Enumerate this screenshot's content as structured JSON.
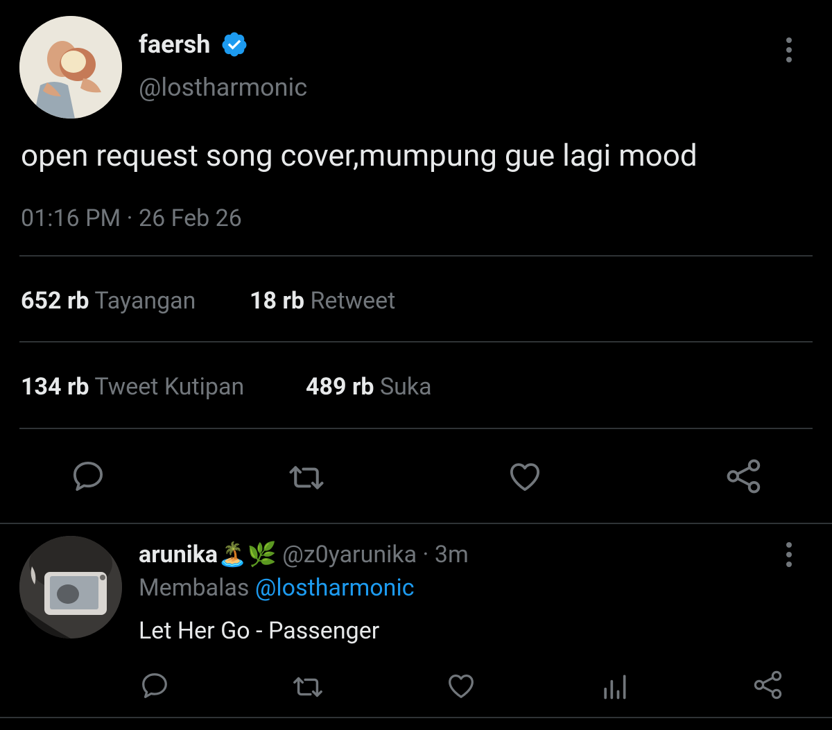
{
  "tweet": {
    "display_name": "faersh",
    "handle": "@lostharmonic",
    "text": "open request song cover,mumpung gue lagi mood",
    "time": "01:16 PM",
    "date": "26 Feb 26",
    "separator": "·",
    "stats": {
      "views_num": "652 rb",
      "views_label": "Tayangan",
      "retweets_num": "18 rb",
      "retweets_label": "Retweet",
      "quotes_num": "134 rb",
      "quotes_label": "Tweet Kutipan",
      "likes_num": "489 rb",
      "likes_label": "Suka"
    }
  },
  "reply": {
    "display_name": "arunika",
    "emojis": "🏝️🌿",
    "handle": "@z0yarunika",
    "separator": "·",
    "age": "3m",
    "replying_prefix": "Membalas",
    "replying_to": "@lostharmonic",
    "text": "Let Her Go - Passenger"
  },
  "colors": {
    "background": "#000000",
    "text": "#e7e9ea",
    "muted": "#71767b",
    "accent": "#1d9bf0",
    "divider": "#2f3336"
  },
  "icons": [
    "verified-badge-icon",
    "more-options-icon",
    "reply-icon",
    "retweet-icon",
    "like-icon",
    "share-icon",
    "analytics-icon"
  ]
}
